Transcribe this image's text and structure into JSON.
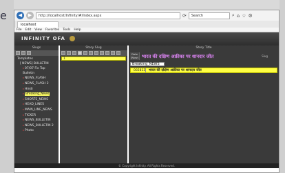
{
  "desktop": {
    "logo_text": "e"
  },
  "browser": {
    "url": "http://localhost/Infinity/#/Index.aspx",
    "search_placeholder": "Search",
    "tab_title": "localhost",
    "menu": [
      "File",
      "Edit",
      "View",
      "Favorites",
      "Tools",
      "Help"
    ]
  },
  "app": {
    "banner_title": "INFINITY OFA",
    "left_pane_title": "Slugs",
    "mid_pane_title": "Story Slug",
    "right_pane_title": "Story Title",
    "left_footer": "Stories",
    "status_bar": "© Copyright Infinity. All Rights Reserved."
  },
  "tree": {
    "root": "Templates",
    "group": "[ NEWS] BULLETIN",
    "items": [
      "07/07 Fix Top Bulletin",
      "NEWS_FLASH",
      "NEWS_FLASH 2",
      "Hindi",
      "Breaking_News",
      "SHORTS_NEWS",
      "HEAD_LINES",
      "MAIN_LINE_NEWS",
      "TICKER",
      "NEWS_BULLETIN",
      "NEWS_BULLETIN 2",
      "Photo"
    ],
    "selected_index": 4
  },
  "middle": {
    "selected_item": "1"
  },
  "right": {
    "date_label": "Date",
    "date_value": "[Now]",
    "headline": "भारत की दक्षिण अफ्रीका पर शानदार जीत",
    "slug_tag": "Slug",
    "slug_input": "Breaking_NEWS",
    "story_id": "002813",
    "story_title": "भारत की दक्षिण अफ्रीका पर शानदार जीत"
  },
  "colors": {
    "highlight_yellow": "#ffff44",
    "headline_pink": "#d983f0",
    "panel_dark": "#3a3a3a"
  }
}
